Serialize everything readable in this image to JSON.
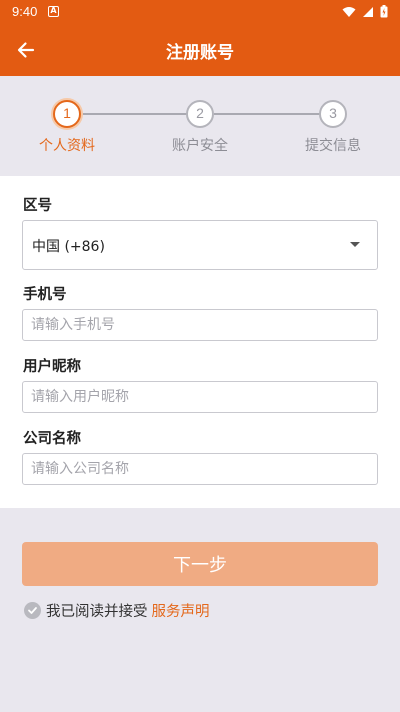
{
  "status_bar": {
    "time": "9:40",
    "notification_icon": "a-icon"
  },
  "app_bar": {
    "title": "注册账号",
    "back_icon": "back-arrow-icon"
  },
  "stepper": {
    "steps": [
      {
        "number": "1",
        "label": "个人资料",
        "active": true
      },
      {
        "number": "2",
        "label": "账户安全",
        "active": false
      },
      {
        "number": "3",
        "label": "提交信息",
        "active": false
      }
    ]
  },
  "form": {
    "region": {
      "label": "区号",
      "value": "中国 (+86)"
    },
    "phone": {
      "label": "手机号",
      "placeholder": "请输入手机号",
      "value": ""
    },
    "nickname": {
      "label": "用户昵称",
      "placeholder": "请输入用户昵称",
      "value": ""
    },
    "company": {
      "label": "公司名称",
      "placeholder": "请输入公司名称",
      "value": ""
    }
  },
  "actions": {
    "next_label": "下一步"
  },
  "agreement": {
    "text": "我已阅读并接受",
    "link": "服务声明",
    "checked": false
  },
  "colors": {
    "primary": "#e35b12",
    "accent": "#e4681b",
    "button_disabled": "#f0ab83",
    "background": "#e9e7ee"
  }
}
